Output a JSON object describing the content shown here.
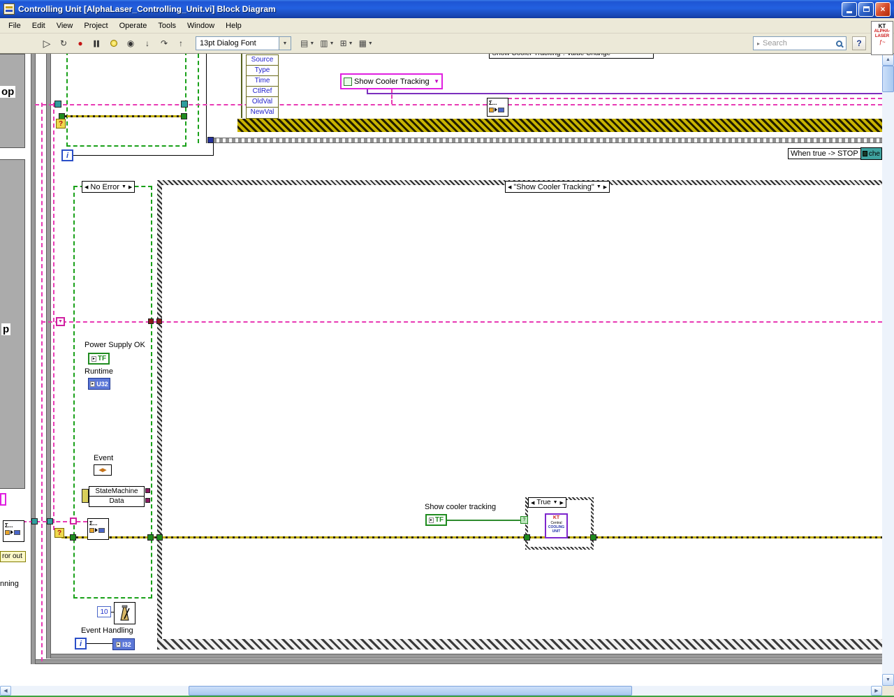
{
  "window": {
    "title": "Controlling Unit [AlphaLaser_Controlling_Unit.vi] Block Diagram",
    "icons": {
      "close": "×"
    }
  },
  "menu": {
    "items": [
      "File",
      "Edit",
      "View",
      "Project",
      "Operate",
      "Tools",
      "Window",
      "Help"
    ]
  },
  "toolbar": {
    "font_selector": "13pt Dialog Font",
    "search_placeholder": "Search",
    "help_label": "?",
    "icons": {
      "run": "▷",
      "run_continuous": "↻",
      "abort": "●",
      "pause": "▌▌",
      "retain_wires": "◉",
      "step_into": "↓",
      "step_over": "↷",
      "step_out": "↑",
      "align": "▤",
      "distribute": "▥",
      "resize": "⊞",
      "reorder": "▦",
      "dropdown": "▼",
      "search_caret": "▸"
    }
  },
  "scrollbars": {
    "up": "▲",
    "down": "▼",
    "left": "◀",
    "right": "▶"
  },
  "logo": {
    "l1": "KT",
    "l2": "ALPHA-",
    "l3": "LASER",
    "sq": "ƒ~"
  },
  "diagram": {
    "partial_top_label": "\"Show Cooler Tracking\": Value Change",
    "event_data_node": [
      "Source",
      "Type",
      "Time",
      "CtlRef",
      "OldVal",
      "NewVal"
    ],
    "cooler_ref_label": "Show Cooler Tracking",
    "when_true_stop": "When true -> STOP",
    "teal_label": "che",
    "selectors": {
      "prev": "◀",
      "next": "▶",
      "drop": "▼",
      "q": "?",
      "event": "\"Show Cooler Tracking\"",
      "no_error": "No Error",
      "true_case": "True"
    },
    "terminals": {
      "tf": "TF",
      "u32": "U32",
      "i32": "I32",
      "iter": "i",
      "arrow": "▸",
      "event_glyph": "◀▶"
    },
    "labels": {
      "power_supply": "Power Supply OK",
      "runtime": "Runtime",
      "event": "Event",
      "statemachine": "StateMachine",
      "data": "Data",
      "show_cooler": "Show cooler tracking",
      "event_handling": "Event Handling",
      "wait_const": "10",
      "error_out": "ror out",
      "running": "nning",
      "left_op": "op",
      "left_p": "p"
    },
    "kt_icon": {
      "l1": "KT",
      "l2": "Central",
      "l3": "COOLING",
      "l4": "UNIT"
    },
    "sigma": "Σ..."
  }
}
